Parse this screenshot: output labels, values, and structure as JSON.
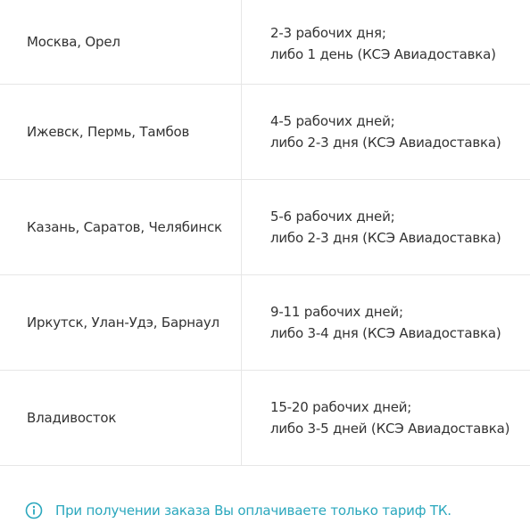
{
  "colors": {
    "text": "#333333",
    "border": "#e6e6e6",
    "accent": "#2aa7bd"
  },
  "rows": [
    {
      "city": "Москва, Орел",
      "time_line1": "2-3 рабочих дня;",
      "time_line2": "либо 1 день (КСЭ Авиадоставка)"
    },
    {
      "city": "Ижевск, Пермь, Тамбов",
      "time_line1": "4-5 рабочих дней;",
      "time_line2": "либо 2-3 дня (КСЭ Авиадоставка)"
    },
    {
      "city": "Казань, Саратов, Челябинск",
      "time_line1": "5-6 рабочих дней;",
      "time_line2": "либо 2-3 дня (КСЭ Авиадоставка)"
    },
    {
      "city": "Иркутск, Улан-Удэ, Барнаул",
      "time_line1": "9-11 рабочих дней;",
      "time_line2": "либо 3-4 дня (КСЭ Авиадоставка)"
    },
    {
      "city": "Владивосток",
      "time_line1": "15-20 рабочих дней;",
      "time_line2": "либо 3-5 дней (КСЭ Авиадоставка)"
    }
  ],
  "note": {
    "icon": "info-icon",
    "text": "При получении заказа Вы оплачиваете только тариф ТК."
  }
}
